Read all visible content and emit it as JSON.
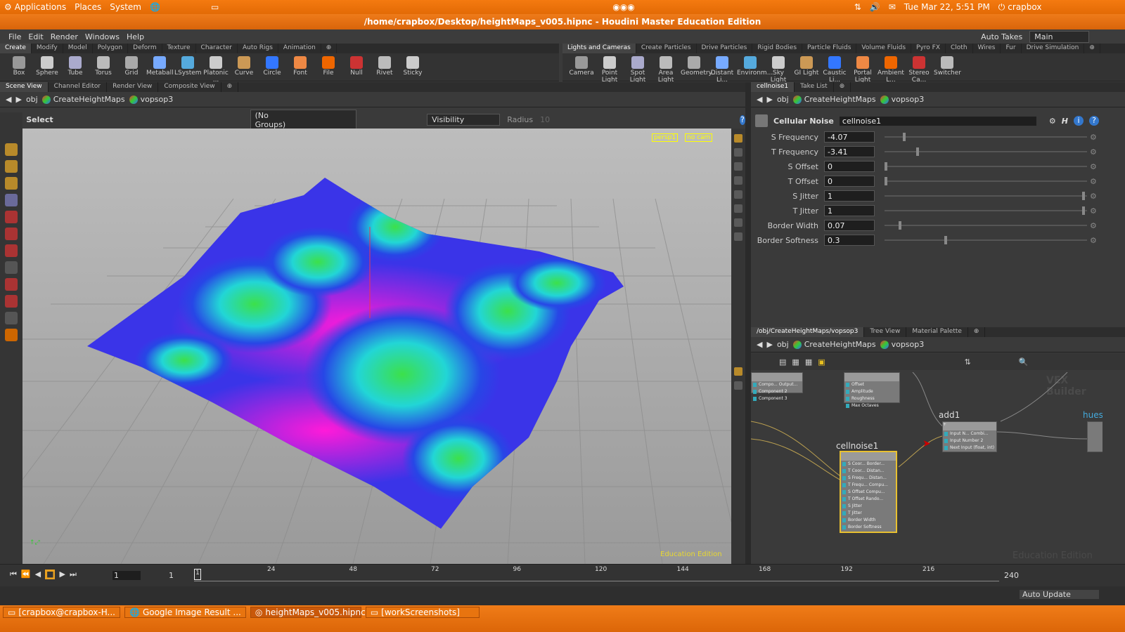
{
  "system": {
    "menus": [
      "Applications",
      "Places",
      "System"
    ],
    "datetime": "Tue Mar 22,  5:51 PM",
    "user": "crapbox"
  },
  "window": {
    "title": "/home/crapbox/Desktop/heightMaps_v005.hipnc - Houdini Master Education Edition"
  },
  "menubar": [
    "File",
    "Edit",
    "Render",
    "Windows",
    "Help"
  ],
  "takes": {
    "label": "Auto Takes",
    "desktop": "Main"
  },
  "shelf_left": {
    "tabs": [
      "Create",
      "Modify",
      "Model",
      "Polygon",
      "Deform",
      "Texture",
      "Character",
      "Auto Rigs",
      "Animation"
    ],
    "tools": [
      "Box",
      "Sphere",
      "Tube",
      "Torus",
      "Grid",
      "Metaball",
      "LSystem",
      "Platonic ...",
      "Curve",
      "Circle",
      "Font",
      "File",
      "Null",
      "Rivet",
      "Sticky"
    ]
  },
  "shelf_right": {
    "tabs": [
      "Lights and Cameras",
      "Create Particles",
      "Drive Particles",
      "Rigid Bodies",
      "Particle Fluids",
      "Volume Fluids",
      "Pyro FX",
      "Cloth",
      "Wires",
      "Fur",
      "Drive Simulation"
    ],
    "tools": [
      "Camera",
      "Point Light",
      "Spot Light",
      "Area Light",
      "Geometry...",
      "Distant Li...",
      "Environm...",
      "Sky Light",
      "GI Light",
      "Caustic Li...",
      "Portal Light",
      "Ambient L...",
      "Stereo Ca...",
      "Switcher"
    ]
  },
  "viewer": {
    "tabs": [
      "Scene View",
      "Channel Editor",
      "Render View",
      "Composite View"
    ],
    "path": [
      "obj",
      "CreateHeightMaps",
      "vopsop3"
    ],
    "select_label": "Select",
    "groups": "(No Groups)",
    "visibility": "Visibility",
    "radius_label": "Radius",
    "radius_value": "10",
    "camera": "persp1",
    "cam": "no cam",
    "watermark": "Education Edition"
  },
  "params": {
    "tabs": [
      "cellnoise1",
      "Take List"
    ],
    "path": [
      "obj",
      "CreateHeightMaps",
      "vopsop3"
    ],
    "node_type": "Cellular Noise",
    "node_name": "cellnoise1",
    "rows": [
      {
        "label": "S Frequency",
        "value": "-4.07",
        "pos": 0.09
      },
      {
        "label": "T Frequency",
        "value": "-3.41",
        "pos": 0.16
      },
      {
        "label": "S Offset",
        "value": "0",
        "pos": 0.0
      },
      {
        "label": "T Offset",
        "value": "0",
        "pos": 0.0
      },
      {
        "label": "S Jitter",
        "value": "1",
        "pos": 0.99
      },
      {
        "label": "T Jitter",
        "value": "1",
        "pos": 0.99
      },
      {
        "label": "Border Width",
        "value": "0.07",
        "pos": 0.07
      },
      {
        "label": "Border Softness",
        "value": "0.3",
        "pos": 0.3
      }
    ]
  },
  "network": {
    "tabs": [
      "/obj/CreateHeightMaps/vopsop3",
      "Tree View",
      "Material Palette"
    ],
    "path": [
      "obj",
      "CreateHeightMaps",
      "vopsop3"
    ],
    "watermark_top": "VEX Builder",
    "watermark_bottom": "Education Edition",
    "nodes": {
      "cellnoise": {
        "name": "cellnoise1",
        "inputs": [
          "S Coor... Border...",
          "T Coor... Distan...",
          "S Frequ... Distan...",
          "T Frequ... Compu...",
          "S Offset   Compu...",
          "T Offset   Rando...",
          "S Jitter",
          "T Jitter",
          "Border Width",
          "Border Softness"
        ]
      },
      "add": {
        "name": "add1",
        "inputs": [
          "Input N...   Combi...",
          "Input Number 2",
          "Next Input (float, int)"
        ]
      },
      "noise_top": {
        "inputs": [
          "Offset",
          "Amplitude",
          "Roughness",
          "Max Octaves"
        ]
      },
      "float_top": {
        "inputs": [
          "Compo... Output...",
          "Component 2",
          "Component 3"
        ]
      },
      "hues": {
        "name": "hues"
      }
    }
  },
  "timeline": {
    "start": "1",
    "current": "1",
    "end": "240",
    "ticks": [
      "24",
      "48",
      "72",
      "96",
      "120",
      "144",
      "168",
      "192",
      "216"
    ]
  },
  "status": {
    "auto_update": "Auto Update"
  },
  "taskbar": [
    "[crapbox@crapbox-H...",
    "Google Image Result ...",
    "heightMaps_v005.hipnc",
    "[workScreenshots]"
  ]
}
